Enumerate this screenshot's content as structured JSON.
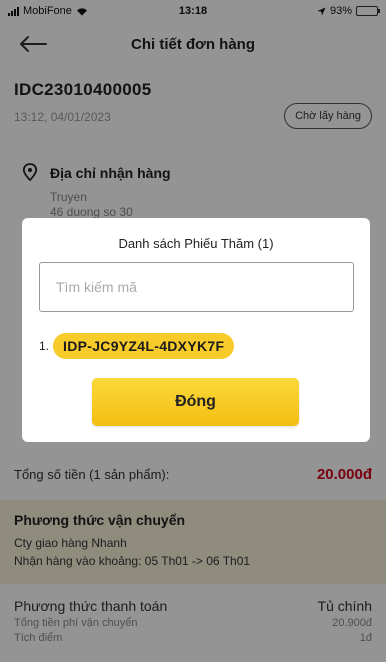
{
  "status_bar": {
    "carrier": "MobiFone",
    "time": "13:18",
    "battery_text": "93%",
    "battery_level": 0.93,
    "battery_color": "#4cd964"
  },
  "header": {
    "back_icon": "arrow-left-icon",
    "title": "Chi tiết đơn hàng"
  },
  "order": {
    "id": "IDC23010400005",
    "datetime": "13:12, 04/01/2023",
    "status": "Chờ lấy hàng"
  },
  "address": {
    "icon": "location-pin-icon",
    "label": "Địa chỉ nhận hàng",
    "name": "Truyen",
    "street": "46 duong so 30"
  },
  "total": {
    "label": "Tổng số tiền (1 sản phẩm):",
    "amount": "20.000đ",
    "amount_color": "#d0021b"
  },
  "shipping": {
    "title": "Phương thức vận chuyển",
    "provider": "Cty giao hàng Nhanh",
    "window": "Nhận hàng vào khoảng: 05 Th01 -> 06 Th01",
    "background": "#f6f1d9"
  },
  "payment": {
    "title": "Phương thức thanh toán",
    "method": "Tủ chính",
    "fee_label": "Tổng tiền phí vận chuyển",
    "fee_value": "20.900đ",
    "points_label": "Tích điểm",
    "points_value": "1đ"
  },
  "modal": {
    "title": "Danh sách Phiếu Thăm (1)",
    "search_placeholder": "Tìm kiếm mã",
    "search_value": "",
    "items": [
      {
        "index": "1.",
        "code": "IDP-JC9YZ4L-4DXYK7F"
      }
    ],
    "close_label": "Đóng",
    "accent": "#f7cc2a"
  }
}
